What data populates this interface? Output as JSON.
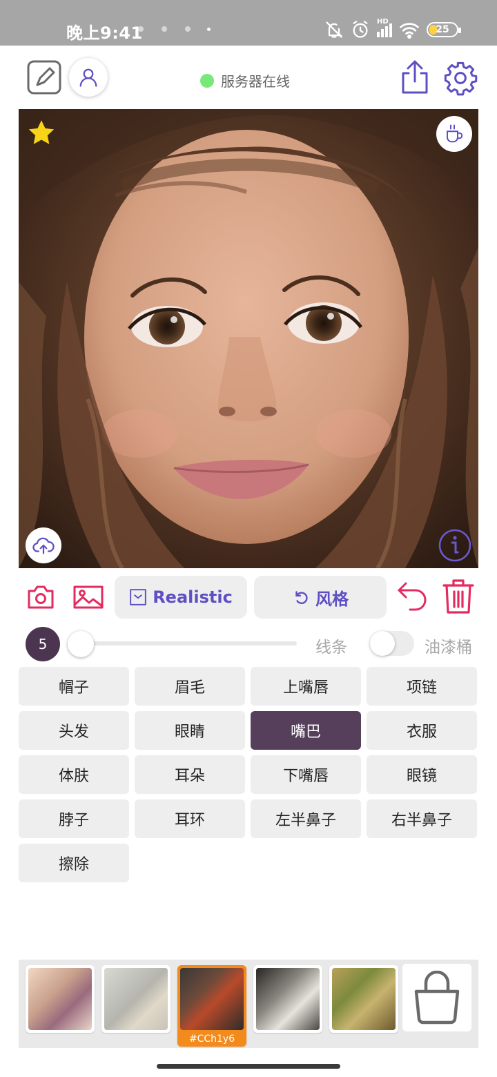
{
  "status_bar": {
    "time": "晚上9:41",
    "network_label": "HD",
    "battery": "25",
    "battery_level": 0.25
  },
  "header": {
    "server_status": "服务器在线"
  },
  "toolbar": {
    "style_button_label": "Realistic",
    "reset_style_label": "风格"
  },
  "brush": {
    "size": "5",
    "line_label": "线条",
    "bucket_label": "油漆桶",
    "bucket_enabled": false
  },
  "parts": [
    {
      "label": "帽子",
      "active": false
    },
    {
      "label": "眉毛",
      "active": false
    },
    {
      "label": "上嘴唇",
      "active": false
    },
    {
      "label": "项链",
      "active": false
    },
    {
      "label": "头发",
      "active": false
    },
    {
      "label": "眼睛",
      "active": false
    },
    {
      "label": "嘴巴",
      "active": true
    },
    {
      "label": "衣服",
      "active": false
    },
    {
      "label": "体肤",
      "active": false
    },
    {
      "label": "耳朵",
      "active": false
    },
    {
      "label": "下嘴唇",
      "active": false
    },
    {
      "label": "眼镜",
      "active": false
    },
    {
      "label": "脖子",
      "active": false
    },
    {
      "label": "耳环",
      "active": false
    },
    {
      "label": "左半鼻子",
      "active": false
    },
    {
      "label": "右半鼻子",
      "active": false
    },
    {
      "label": "擦除",
      "active": false
    }
  ],
  "styles": [
    {
      "selected": false,
      "code": ""
    },
    {
      "selected": false,
      "code": ""
    },
    {
      "selected": true,
      "code": "#CCh1y6"
    },
    {
      "selected": false,
      "code": ""
    },
    {
      "selected": false,
      "code": ""
    }
  ],
  "colors": {
    "accent_purple": "#5d4fc4",
    "accent_red": "#e32b5f",
    "selected_part": "#553f5b",
    "server_online": "#78e878",
    "selected_style": "#f28a1c"
  },
  "icons": {
    "edit": "edit-square-icon",
    "user": "user-icon",
    "share": "share-icon",
    "settings": "gear-icon",
    "favorite": "star-icon",
    "coffee": "coffee-cup-icon",
    "upload": "cloud-upload-icon",
    "info": "info-icon",
    "camera": "camera-icon",
    "gallery": "image-icon",
    "undo": "undo-icon",
    "delete": "trash-icon",
    "bag": "shopping-bag-icon"
  }
}
